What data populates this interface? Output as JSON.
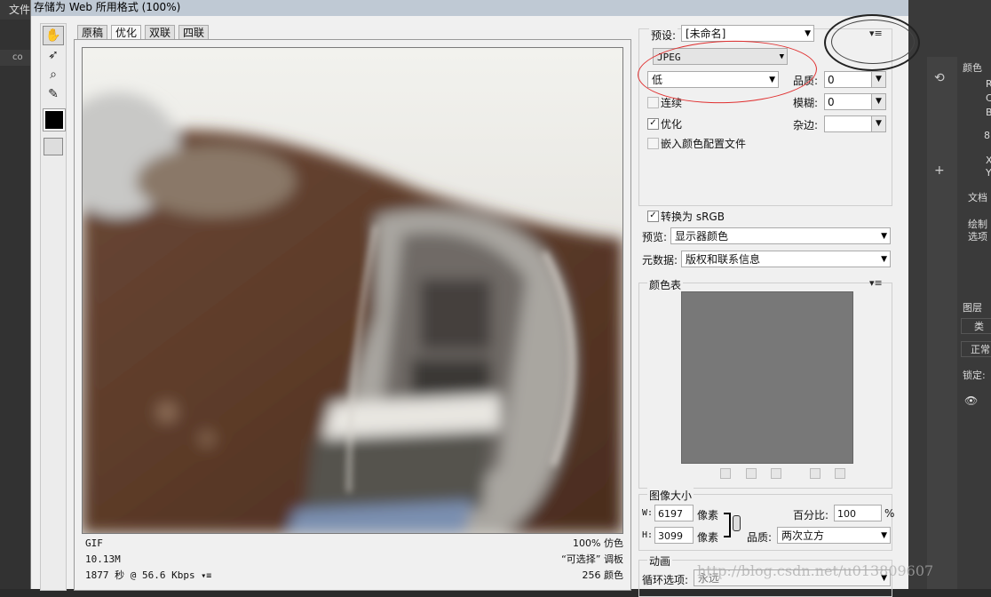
{
  "dialog": {
    "title": "存储为 Web 所用格式 (100%)"
  },
  "background_app": {
    "menu_label": "文件",
    "left_tab": "co",
    "right_panels": {
      "color_tab": "颜色",
      "doc_label": "文档",
      "draw_label_1": "绘制",
      "draw_label_2": "选项",
      "layers_tab": "图层",
      "layers_search": "类",
      "blend_mode": "正常",
      "lock_label": "锁定:",
      "readout_r": "R",
      "readout_c": "C",
      "readout_b": "B",
      "readout_8": "8",
      "readout_x": "X",
      "readout_y": "Y"
    }
  },
  "tools": [
    "hand-tool",
    "slice-select-tool",
    "zoom-tool",
    "eyedropper-tool"
  ],
  "view_tabs": [
    "原稿",
    "优化",
    "双联",
    "四联"
  ],
  "view_tabs_active": "优化",
  "preview_info": {
    "format": "GIF",
    "size": "10.13M",
    "time": "1877 秒 @ 56.6 Kbps",
    "dither_label": "100% 仿色",
    "palette_label": "“可选择” 调板",
    "colors_label": "256 颜色"
  },
  "settings": {
    "preset_label": "预设:",
    "preset_value": "[未命名]",
    "format_value": "JPEG",
    "quality_preset": "低",
    "quality_label": "品质:",
    "quality_value": "0",
    "blur_label": "模糊:",
    "blur_value": "0",
    "matte_label": "杂边:",
    "matte_value": "",
    "progressive_label": "连续",
    "progressive_checked": false,
    "optimized_label": "优化",
    "optimized_checked": true,
    "embed_profile_label": "嵌入颜色配置文件",
    "embed_profile_checked": false,
    "convert_srgb_label": "转换为 sRGB",
    "convert_srgb_checked": true,
    "preview_label": "预览:",
    "preview_value": "显示器颜色",
    "metadata_label": "元数据:",
    "metadata_value": "版权和联系信息"
  },
  "color_table": {
    "title": "颜色表",
    "swatch_color": "#787878"
  },
  "image_size": {
    "title": "图像大小",
    "w_label": "W:",
    "w_value": "6197",
    "h_label": "H:",
    "h_value": "3099",
    "unit_w": "像素",
    "unit_h": "像素",
    "percent_label": "百分比:",
    "percent_value": "100",
    "percent_unit": "%",
    "quality_label": "品质:",
    "quality_value": "两次立方"
  },
  "animation": {
    "title": "动画",
    "loop_label": "循环选项:",
    "loop_value": "永远"
  },
  "watermark": "http://blog.csdn.net/u013809607",
  "colors": {
    "annotation_red": "#e03030",
    "annotation_black": "#222222"
  }
}
